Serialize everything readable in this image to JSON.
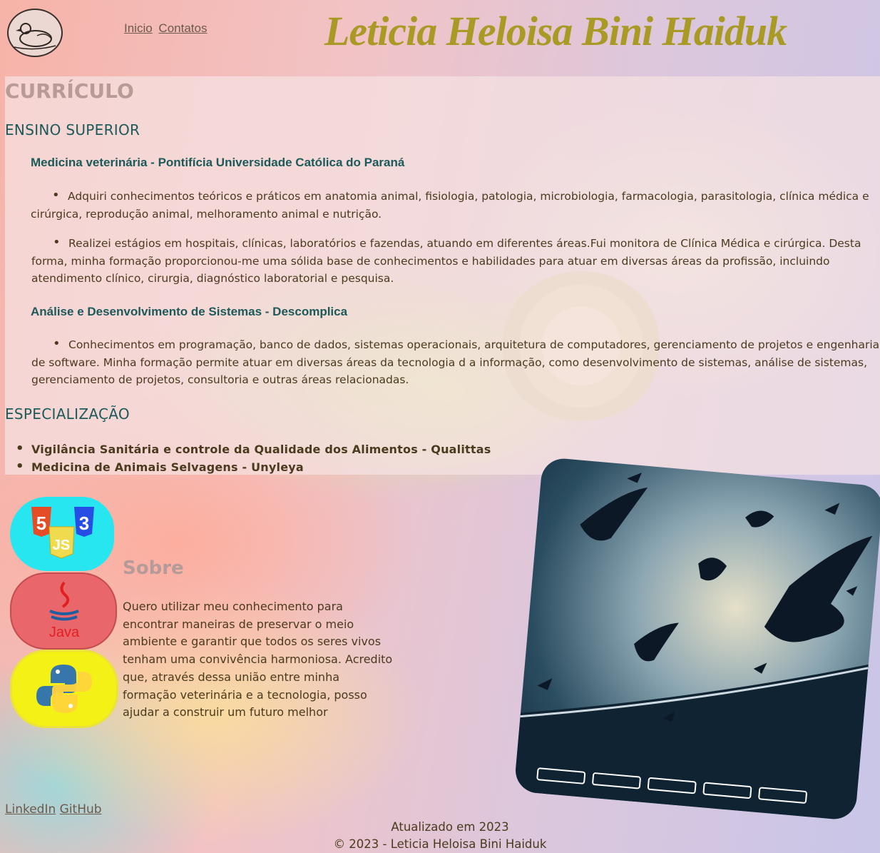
{
  "header": {
    "nav": [
      "Inicio",
      "Contatos"
    ],
    "brand": "Leticia Heloisa Bini Haiduk"
  },
  "cv": {
    "title": "CURRÍCULO",
    "ensino_superior": {
      "heading": "ENSINO SUPERIOR",
      "course1": {
        "title": "Medicina veterinária - Pontifícia Universidade Católica do Paraná",
        "items": [
          "Adquiri conhecimentos teóricos e práticos em anatomia animal, fisiologia, patologia, microbiologia, farmacologia, parasitologia, clínica médica e cirúrgica, reprodução animal, melhoramento animal e nutrição.",
          "Realizei estágios em hospitais, clínicas, laboratórios e fazendas, atuando em diferentes áreas.Fui monitora de Clínica Médica e cirúrgica. Desta forma, minha formação proporcionou-me uma sólida base de conhecimentos e habilidades para atuar em diversas áreas da profissão, incluindo atendimento clínico, cirurgia, diagnóstico laboratorial e pesquisa."
        ]
      },
      "course2": {
        "title": "Análise e Desenvolvimento de Sistemas - Descomplica",
        "items": [
          "Conhecimentos em programação, banco de dados, sistemas operacionais, arquitetura de computadores, gerenciamento de projetos e engenharia de software. Minha formação permite atuar em diversas áreas da tecnologia d a informação, como desenvolvimento de sistemas, análise de sistemas, gerenciamento de projetos, consultoria e outras áreas relacionadas."
        ]
      }
    },
    "especializacao": {
      "heading": "ESPECIALIZAÇÃO",
      "items": [
        "Vigilância Sanitária e controle da Qualidade dos Alimentos - Qualittas",
        "Medicina de Animais Selvagens - Unyleya"
      ]
    }
  },
  "badges": {
    "html_icon_text": [
      "5",
      "3",
      "JS"
    ],
    "java_label": "Java"
  },
  "sobre": {
    "title": "Sobre",
    "text": "Quero utilizar meu conhecimento para encontrar maneiras de preservar o meio ambiente e garantir que todos os seres vivos tenham uma convivência harmoniosa. Acredito que, através dessa união entre minha formação veterinária e a tecnologia, posso ajudar a construir um futuro melhor"
  },
  "social": [
    "LinkedIn",
    "GitHub"
  ],
  "footer": {
    "updated": "Atualizado em 2023",
    "copyright": "© 2023 - Leticia Heloisa Bini Haiduk"
  },
  "carousel": {
    "slide_count": 5
  }
}
